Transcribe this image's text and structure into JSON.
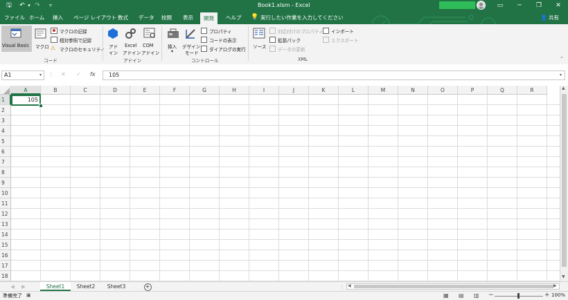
{
  "titlebar": {
    "title": "Book1.xlsm  -  Excel",
    "qat": {
      "save": "🖫",
      "undo": "↶",
      "undo_dd": "▾",
      "redo": "↷",
      "customize": "▿"
    },
    "window_buttons": {
      "ribbon_display": "▭",
      "minimize": "─",
      "restore": "❐",
      "close": "✕"
    }
  },
  "menu": {
    "tabs": [
      "ファイル",
      "ホーム",
      "挿入",
      "ページ レイアウト",
      "数式",
      "データ",
      "校閲",
      "表示",
      "開発",
      "ヘルプ"
    ],
    "active_tab": "開発",
    "tell_me": "実行したい作業を入力してください",
    "share": "共有"
  },
  "ribbon": {
    "code": {
      "visual_basic": "Visual Basic",
      "macro": "マクロ",
      "record_macro": "マクロの記録",
      "relative_ref": "相対参照で記録",
      "macro_security": "マクロのセキュリティ",
      "label": "コード"
    },
    "addins": {
      "addin_1": "アド",
      "addin_2": "イン",
      "excel_addin_1": "Excel",
      "excel_addin_2": "アドイン",
      "com_addin_1": "COM",
      "com_addin_2": "アドイン",
      "label": "アドイン"
    },
    "controls": {
      "insert": "挿入",
      "design_mode_1": "デザイン",
      "design_mode_2": "モード",
      "properties": "プロパティ",
      "view_code": "コードの表示",
      "run_dialog": "ダイアログの実行",
      "label": "コントロール"
    },
    "xml": {
      "source": "ソース",
      "map_properties": "対応付けのプロパティ",
      "expansion_packs": "拡張パック",
      "refresh_data": "データの更新",
      "import": "インポート",
      "export": "エクスポート",
      "label": "XML"
    }
  },
  "formula_bar": {
    "name_box": "A1",
    "cancel": "✕",
    "enter": "✓",
    "fx": "fx",
    "content": "105"
  },
  "grid": {
    "columns": [
      "A",
      "B",
      "C",
      "D",
      "E",
      "F",
      "G",
      "H",
      "I",
      "J",
      "K",
      "L",
      "M",
      "N",
      "O",
      "P",
      "Q",
      "R"
    ],
    "rows": [
      "1",
      "2",
      "3",
      "4",
      "5",
      "6",
      "7",
      "8",
      "9",
      "10",
      "11",
      "12",
      "13",
      "14",
      "15",
      "16",
      "17",
      "18"
    ],
    "cells": {
      "A1": "105"
    },
    "active_cell": "A1"
  },
  "sheets": {
    "tabs": [
      "Sheet1",
      "Sheet2",
      "Sheet3"
    ],
    "active": "Sheet1",
    "add": "+"
  },
  "status": {
    "ready": "準備完了",
    "zoom_out": "−",
    "zoom_in": "+",
    "zoom": "100%"
  },
  "colors": {
    "brand": "#217346",
    "user_bar": "#2ebd59"
  }
}
